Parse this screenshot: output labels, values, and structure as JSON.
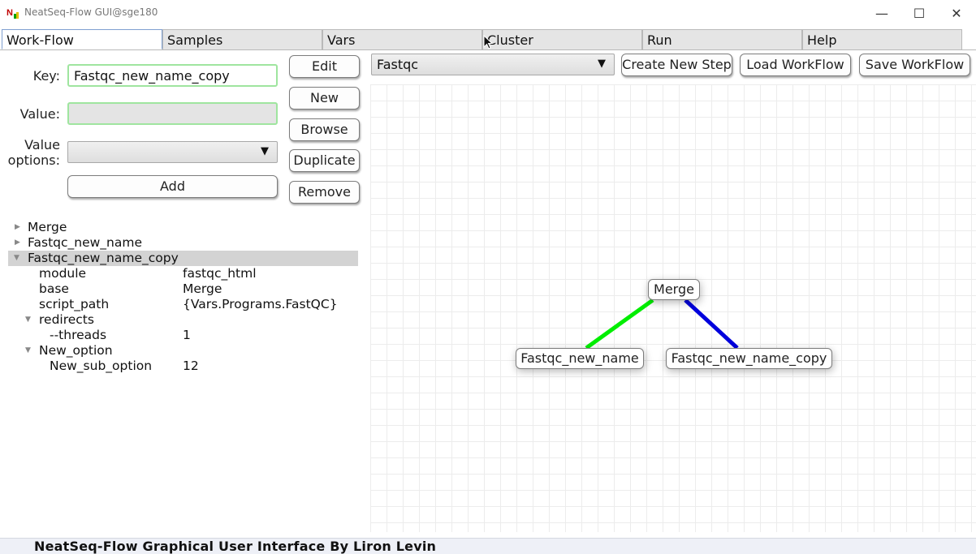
{
  "window": {
    "title": "NeatSeq-Flow GUI@sge180",
    "minimize_glyph": "—",
    "maximize_glyph": "☐",
    "close_glyph": "✕"
  },
  "tabs": [
    {
      "label": "Work-Flow",
      "active": true
    },
    {
      "label": "Samples",
      "active": false
    },
    {
      "label": "Vars",
      "active": false
    },
    {
      "label": "Cluster",
      "active": false
    },
    {
      "label": "Run",
      "active": false
    },
    {
      "label": "Help",
      "active": false
    }
  ],
  "form": {
    "key_label": "Key:",
    "key_value": "Fastqc_new_name_copy",
    "value_label": "Value:",
    "value_value": "",
    "value_options_label_line1": "Value",
    "value_options_label_line2": "options:",
    "value_options_selected": "",
    "add_label": "Add"
  },
  "side_buttons": {
    "edit": "Edit",
    "new": "New",
    "browse": "Browse",
    "duplicate": "Duplicate",
    "remove": "Remove"
  },
  "toolbar": {
    "step_select": "Fastqc",
    "create_new_step": "Create New Step",
    "load_workflow": "Load WorkFlow",
    "save_workflow": "Save WorkFlow"
  },
  "tree": [
    {
      "text": "Merge",
      "expanded": false
    },
    {
      "text": "Fastqc_new_name",
      "expanded": false
    },
    {
      "text": "Fastqc_new_name_copy",
      "expanded": true,
      "selected": true
    },
    {
      "key": "module",
      "value": "fastqc_html"
    },
    {
      "key": "base",
      "value": "Merge"
    },
    {
      "key": "script_path",
      "value": "{Vars.Programs.FastQC}"
    },
    {
      "text": "redirects",
      "expanded": true
    },
    {
      "key": "--threads",
      "value": "1"
    },
    {
      "text": "New_option",
      "expanded": true
    },
    {
      "key": "New_sub_option",
      "value": "12"
    }
  ],
  "graph": {
    "nodes": [
      "Merge",
      "Fastqc_new_name",
      "Fastqc_new_name_copy"
    ],
    "edges": [
      {
        "from": "Merge",
        "to": "Fastqc_new_name",
        "color": "#00ee00"
      },
      {
        "from": "Merge",
        "to": "Fastqc_new_name_copy",
        "color": "#0000dd"
      }
    ]
  },
  "status": "NeatSeq-Flow Graphical User Interface By Liron Levin",
  "colors": {
    "active_tab_border": "#7f9fd0",
    "field_border": "#9fe59f",
    "edge_green": "#00ee00",
    "edge_blue": "#0000dd"
  }
}
